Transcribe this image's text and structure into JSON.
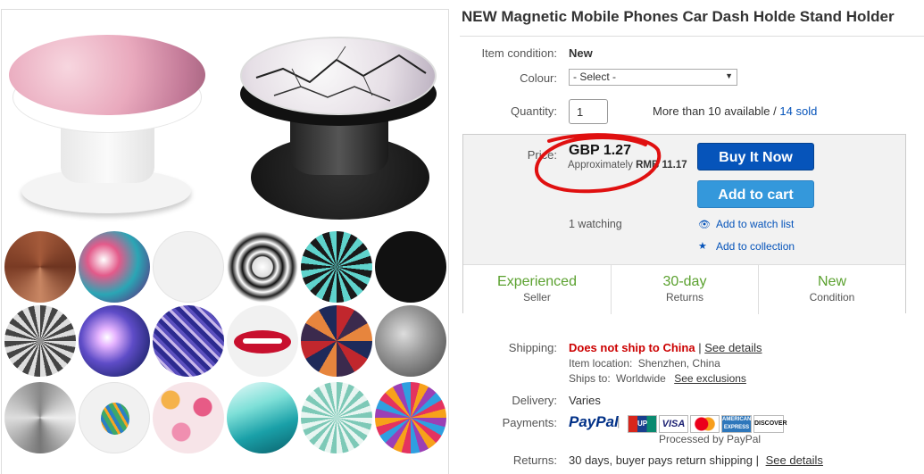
{
  "listing": {
    "title": "NEW Magnetic Mobile Phones Car Dash Holde Stand Holder",
    "condition_label": "Item condition:",
    "condition_value": "New",
    "colour_label": "Colour:",
    "colour_selected": "- Select -",
    "quantity_label": "Quantity:",
    "quantity_value": "1",
    "availability": "More than 10 available",
    "availability_sep": "/",
    "sold": "14 sold"
  },
  "buybox": {
    "price_label": "Price:",
    "price": "GBP 1.27",
    "approx_prefix": "Approximately",
    "approx_value": "RMB 11.17",
    "buy_now": "Buy It Now",
    "add_to_cart": "Add to cart",
    "watching": "1 watching",
    "add_watch": "Add to watch list",
    "add_collection": "Add to collection",
    "badges": [
      {
        "big": "Experienced",
        "small": "Seller"
      },
      {
        "big": "30-day",
        "small": "Returns"
      },
      {
        "big": "New",
        "small": "Condition"
      }
    ]
  },
  "shipping": {
    "label": "Shipping:",
    "status": "Does not ship to China",
    "sep": "|",
    "details": "See details",
    "location_label": "Item location:",
    "location": "Shenzhen, China",
    "ships_to_label": "Ships to:",
    "ships_to": "Worldwide",
    "exclusions": "See exclusions"
  },
  "delivery": {
    "label": "Delivery:",
    "value": "Varies"
  },
  "payments": {
    "label": "Payments:",
    "paypal": "PayPal",
    "cards": [
      "UnionPay",
      "VISA",
      "MasterCard",
      "AMERICAN EXPRESS",
      "DISCOVER"
    ],
    "processed": "Processed by PayPal"
  },
  "returns": {
    "label": "Returns:",
    "value": "30 days, buyer pays return shipping",
    "sep": "|",
    "details": "See details"
  },
  "colors": {
    "buy_button": "#0654ba",
    "cart_button": "#3498db",
    "badge_text": "#5ba12f",
    "warning": "#cc0000",
    "annotation": "#e01010"
  }
}
